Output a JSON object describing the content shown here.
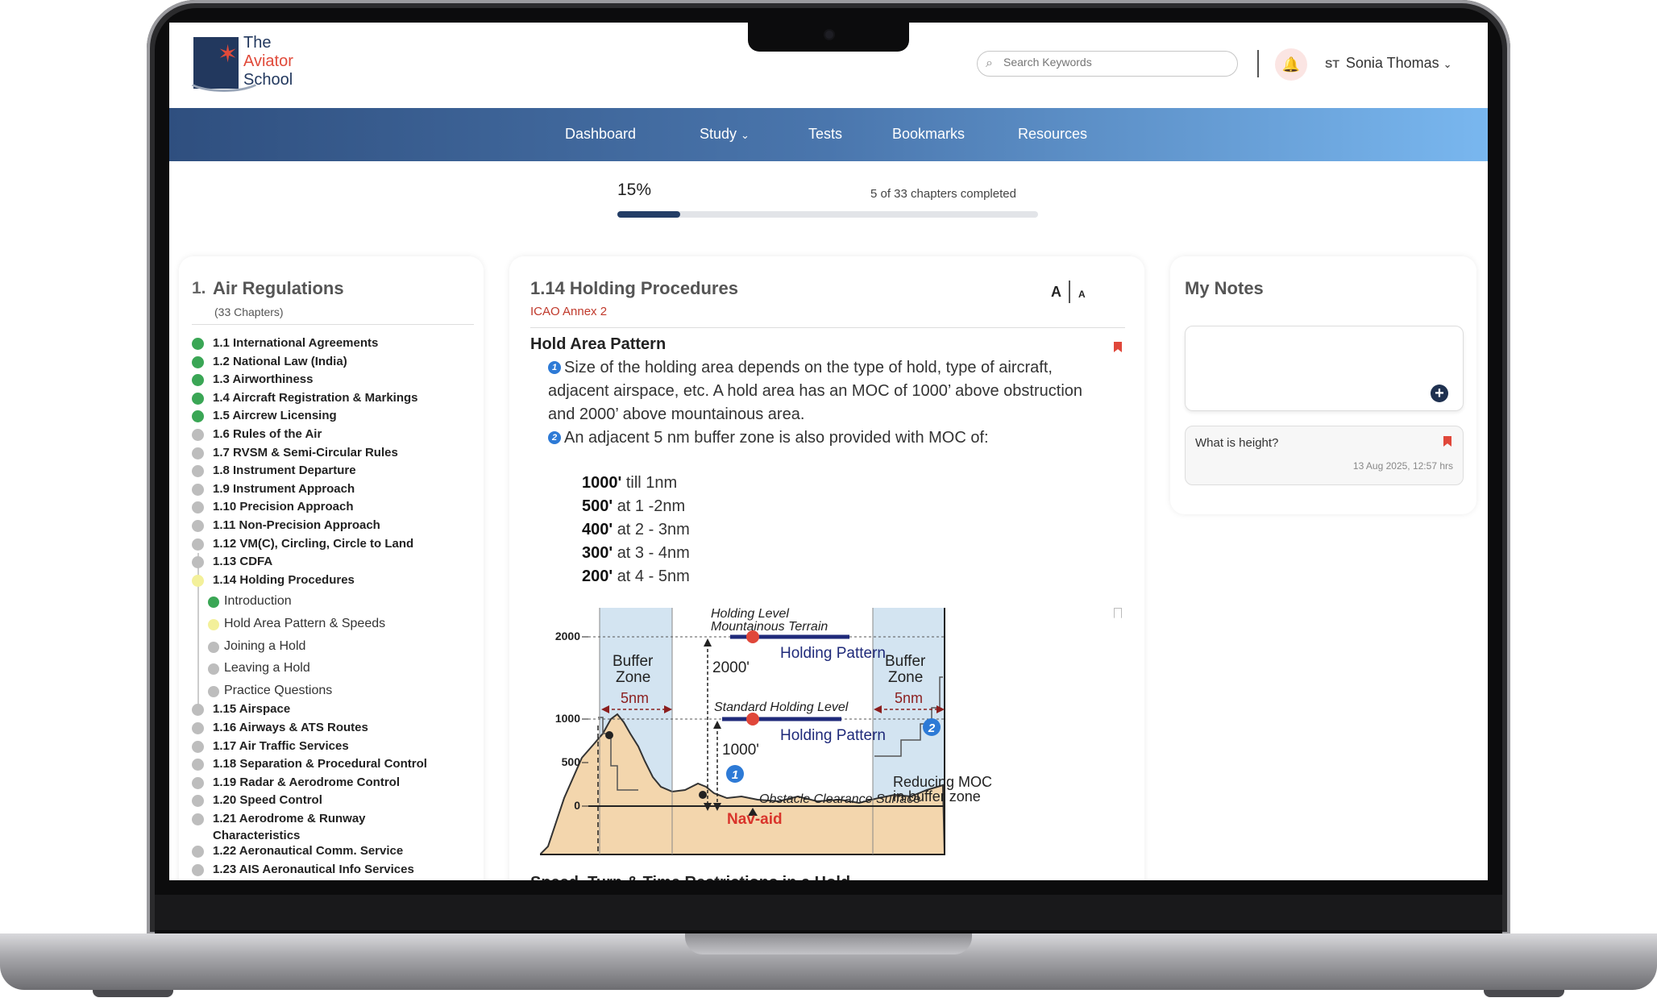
{
  "app": {
    "logo_lines": [
      "The",
      "Aviator",
      "School"
    ]
  },
  "header": {
    "search_placeholder": "Search Keywords",
    "user_initials": "ST",
    "user_name": "Sonia Thomas"
  },
  "nav": {
    "items": [
      {
        "label": "Dashboard"
      },
      {
        "label": "Study"
      },
      {
        "label": "Tests"
      },
      {
        "label": "Bookmarks"
      },
      {
        "label": "Resources"
      }
    ]
  },
  "progress": {
    "percent_label": "15%",
    "value": 0.15,
    "status": "5 of 33 chapters completed"
  },
  "subject": {
    "number": "1.",
    "title": "Air Regulations",
    "subtitle": "(33 Chapters)",
    "chapters": [
      {
        "label": "1.1 International Agreements",
        "status": "done"
      },
      {
        "label": "1.2 National Law (India)",
        "status": "done"
      },
      {
        "label": "1.3 Airworthiness",
        "status": "done"
      },
      {
        "label": "1.4 Aircraft Registration & Markings",
        "status": "done"
      },
      {
        "label": "1.5 Aircrew Licensing",
        "status": "done"
      },
      {
        "label": "1.6 Rules of the Air",
        "status": "todo"
      },
      {
        "label": "1.7 RVSM & Semi-Circular Rules",
        "status": "todo"
      },
      {
        "label": "1.8 Instrument Departure",
        "status": "todo"
      },
      {
        "label": "1.9 Instrument Approach",
        "status": "todo"
      },
      {
        "label": "1.10 Precision Approach",
        "status": "todo"
      },
      {
        "label": "1.11 Non-Precision Approach",
        "status": "todo"
      },
      {
        "label": "1.12 VM(C), Circling, Circle to Land",
        "status": "todo"
      },
      {
        "label": "1.13 CDFA",
        "status": "todo"
      },
      {
        "label": "1.14 Holding Procedures",
        "status": "current"
      }
    ],
    "subtopics": [
      {
        "label": "Introduction",
        "status": "done"
      },
      {
        "label": "Hold Area Pattern & Speeds",
        "status": "current"
      },
      {
        "label": "Joining a Hold",
        "status": "todo"
      },
      {
        "label": "Leaving a Hold",
        "status": "todo"
      },
      {
        "label": "Practice Questions",
        "status": "todo"
      }
    ],
    "chapters_after": [
      {
        "label": "1.15 Airspace",
        "status": "todo"
      },
      {
        "label": "1.16 Airways & ATS Routes",
        "status": "todo"
      },
      {
        "label": "1.17 Air Traffic Services",
        "status": "todo"
      },
      {
        "label": "1.18 Separation & Procedural Control",
        "status": "todo"
      },
      {
        "label": "1.19 Radar & Aerodrome Control",
        "status": "todo"
      },
      {
        "label": "1.20 Speed Control",
        "status": "todo"
      },
      {
        "label": "1.21 Aerodrome & Runway",
        "label2": "Characteristics",
        "status": "todo"
      },
      {
        "label": "1.22 Aeronautical Comm. Service",
        "status": "todo"
      },
      {
        "label": "1.23 AIS Aeronautical Info Services",
        "status": "todo"
      }
    ]
  },
  "content": {
    "title": "1.14 Holding Procedures",
    "source": "ICAO Annex 2",
    "font_large": "A",
    "font_small": "A",
    "section1": "Hold Area Pattern",
    "point1_num": "1",
    "point1": "Size of the holding area depends on the type of hold, type of aircraft, adjacent airspace, etc. A hold area has an MOC of 1000’ above obstruction and 2000’ above mountainous area.",
    "point2_num": "2",
    "point2": "An adjacent 5 nm buffer zone is also provided with MOC of:",
    "moc": [
      {
        "value": "1000'",
        "range": "till 1nm"
      },
      {
        "value": "500'",
        "range": "at 1 -2nm"
      },
      {
        "value": "400'",
        "range": "at 2 - 3nm"
      },
      {
        "value": "300'",
        "range": "at 3 - 4nm"
      },
      {
        "value": "200'",
        "range": "at 4 - 5nm"
      }
    ],
    "diagram": {
      "y_ticks": [
        "2000",
        "1000",
        "500",
        "0"
      ],
      "buffer_zone": [
        "Buffer",
        "Zone"
      ],
      "five_nm": "5nm",
      "holding_level": "Holding Level",
      "mountainous_terrain": "Mountainous Terrain",
      "holding_pattern": "Holding Pattern",
      "std_holding_level": "Standard Holding Level",
      "moc_2000": "2000'",
      "moc_1000": "1000'",
      "ocs": "Obstacle Clearance Surface",
      "navaid": "Nav-aid",
      "reducing_moc": [
        "Reducing MOC",
        "in buffer zone"
      ],
      "marker1": "1",
      "marker2": "2"
    },
    "section2": "Speed, Turn & Time Restrictions in a Hold"
  },
  "notes": {
    "title": "My Notes",
    "items": [
      {
        "text": "What is height?",
        "date": "13 Aug 2025, 12:57 hrs"
      }
    ]
  },
  "colors": {
    "done": "#3aa655",
    "todo": "#bdbdbd",
    "current": "#f3f09a",
    "accent_red": "#c0392b",
    "navy": "#22385e"
  }
}
